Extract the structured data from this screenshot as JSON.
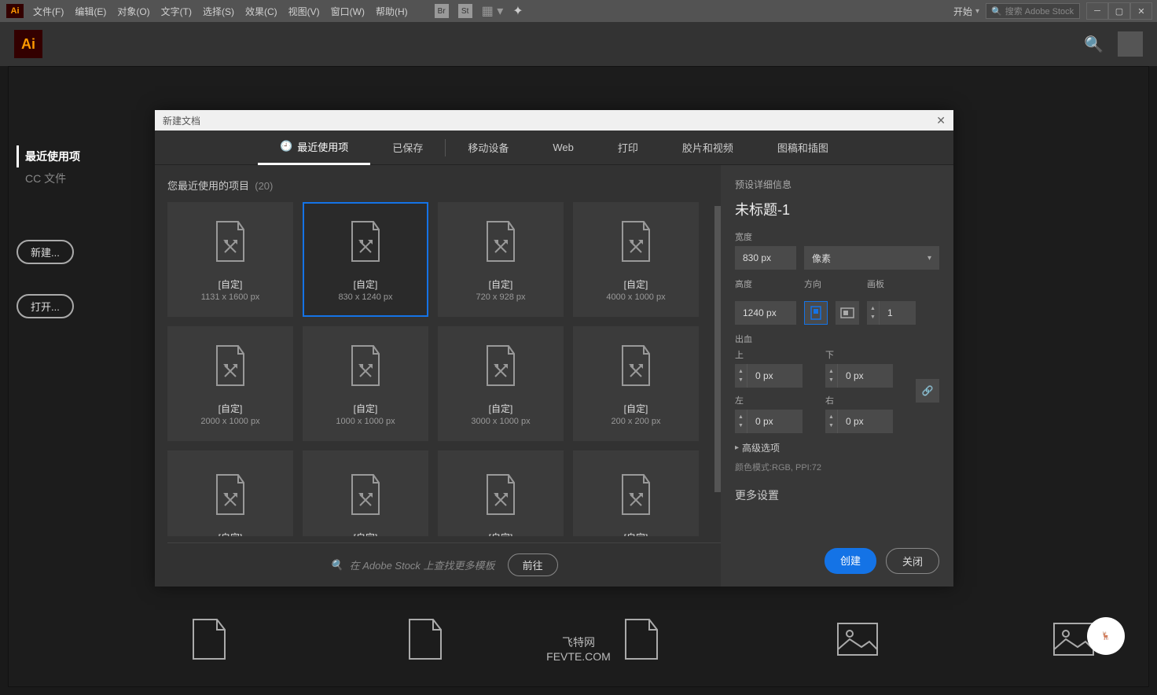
{
  "menubar": {
    "logo": "Ai",
    "items": [
      "文件(F)",
      "编辑(E)",
      "对象(O)",
      "文字(T)",
      "选择(S)",
      "效果(C)",
      "视图(V)",
      "窗口(W)",
      "帮助(H)"
    ],
    "top_icons": [
      "Br",
      "St"
    ],
    "start_label": "开始",
    "search_placeholder": "搜索 Adobe Stock"
  },
  "sidebar": {
    "items": [
      "最近使用项",
      "CC 文件"
    ],
    "new_btn": "新建...",
    "open_btn": "打开..."
  },
  "dialog": {
    "title": "新建文档",
    "tabs": [
      "最近使用项",
      "已保存",
      "移动设备",
      "Web",
      "打印",
      "胶片和视频",
      "图稿和插图"
    ],
    "recent_label": "您最近使用的项目",
    "recent_count": "(20)",
    "presets": [
      {
        "label": "[自定]",
        "dim": "1131 x 1600 px"
      },
      {
        "label": "[自定]",
        "dim": "830 x 1240 px"
      },
      {
        "label": "[自定]",
        "dim": "720 x 928 px"
      },
      {
        "label": "[自定]",
        "dim": "4000 x 1000 px"
      },
      {
        "label": "[自定]",
        "dim": "2000 x 1000 px"
      },
      {
        "label": "[自定]",
        "dim": "1000 x 1000 px"
      },
      {
        "label": "[自定]",
        "dim": "3000 x 1000 px"
      },
      {
        "label": "[自定]",
        "dim": "200 x 200 px"
      },
      {
        "label": "[自定]",
        "dim": ""
      },
      {
        "label": "[自定]",
        "dim": ""
      },
      {
        "label": "[自定]",
        "dim": ""
      },
      {
        "label": "[自定]",
        "dim": ""
      }
    ],
    "stock_search": "在 Adobe Stock 上查找更多模板",
    "go_btn": "前往",
    "details": {
      "header": "预设详细信息",
      "name": "未标题-1",
      "width_label": "宽度",
      "width": "830 px",
      "unit": "像素",
      "height_label": "高度",
      "height": "1240 px",
      "orient_label": "方向",
      "artboard_label": "画板",
      "artboards": "1",
      "bleed_label": "出血",
      "top_label": "上",
      "bottom_label": "下",
      "left_label": "左",
      "right_label": "右",
      "bleed_top": "0 px",
      "bleed_bottom": "0 px",
      "bleed_left": "0 px",
      "bleed_right": "0 px",
      "advanced": "高级选项",
      "color_mode": "颜色模式:RGB, PPI:72",
      "more_settings": "更多设置",
      "create_btn": "创建",
      "close_btn": "关闭"
    }
  },
  "watermark": {
    "l1": "飞特网",
    "l2": "FEVTE.COM"
  },
  "badge": "飞特网"
}
